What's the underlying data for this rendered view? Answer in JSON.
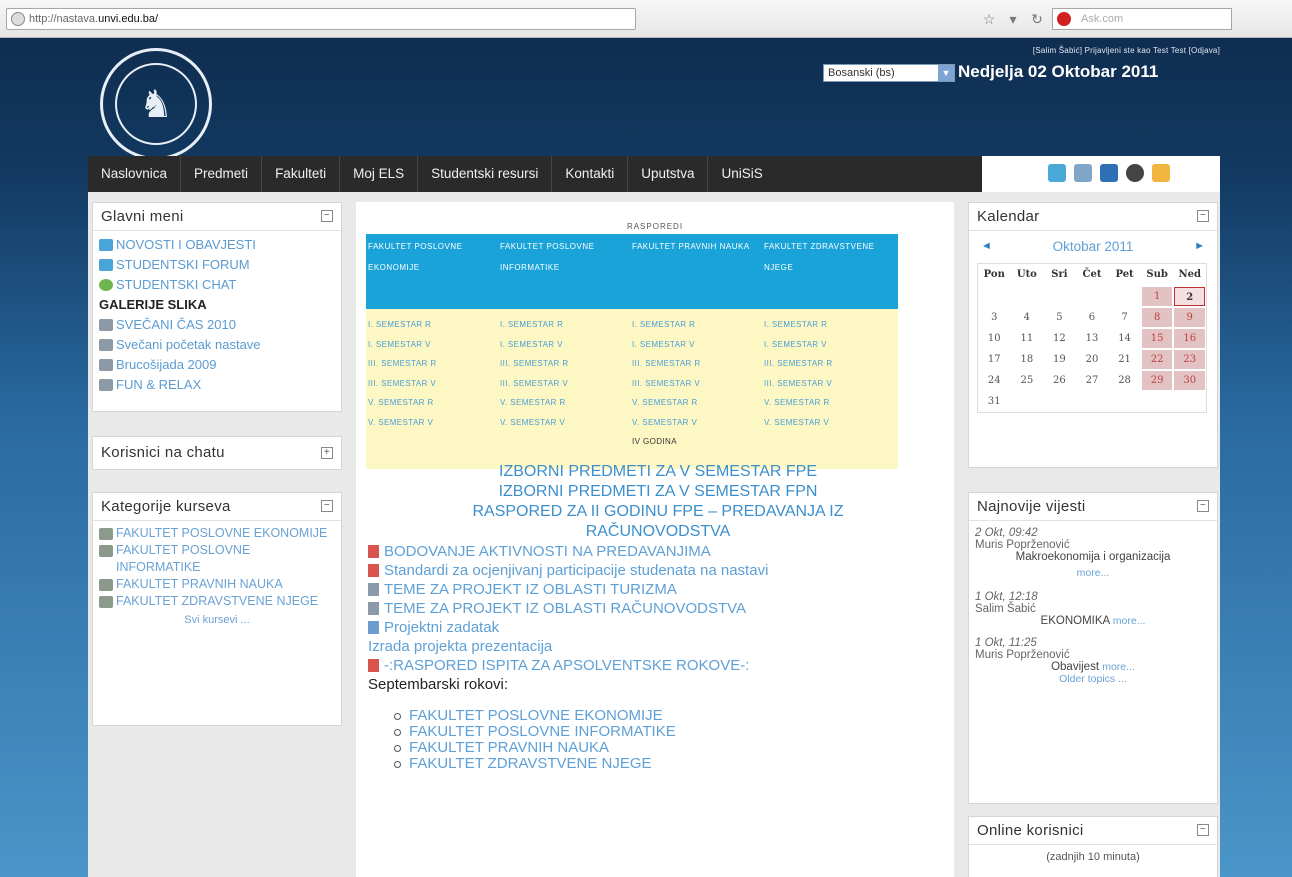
{
  "browser": {
    "url_prefix": "http://nastava.",
    "url_host": "unvi.edu.ba/",
    "search_placeholder": "Ask.com"
  },
  "header": {
    "login_info": "[Salim Šabić] Prijavljeni ste kao Test Test [Odjava]",
    "language": "Bosanski (bs)",
    "date": "Nedjelja 02 Oktobar 2011"
  },
  "nav": {
    "items": [
      "Naslovnica",
      "Predmeti",
      "Fakulteti",
      "Moj ELS",
      "Studentski resursi",
      "Kontakti",
      "Uputstva",
      "UniSiS"
    ]
  },
  "main_menu": {
    "title": "Glavni meni",
    "items": [
      {
        "label": "NOVOSTI I OBAVJESTI",
        "icon": "news-icon"
      },
      {
        "label": "STUDENTSKI FORUM",
        "icon": "forum-icon"
      },
      {
        "label": "STUDENTSKI CHAT",
        "icon": "chat-icon"
      },
      {
        "label": "GALERIJE SLIKA",
        "icon": ""
      },
      {
        "label": "SVEČANI ČAS 2010",
        "icon": "gallery-icon"
      },
      {
        "label": "Svečani početak nastave",
        "icon": "gallery-icon"
      },
      {
        "label": "Brucošijada 2009",
        "icon": "gallery-icon"
      },
      {
        "label": "FUN & RELAX",
        "icon": "gallery-icon"
      }
    ]
  },
  "chat_users": {
    "title": "Korisnici na chatu"
  },
  "categories": {
    "title": "Kategorije kurseva",
    "items": [
      "FAKULTET POSLOVNE EKONOMIJE",
      "FAKULTET POSLOVNE INFORMATIKE",
      "FAKULTET PRAVNIH NAUKA",
      "FAKULTET ZDRAVSTVENE NJEGE"
    ],
    "all_courses": "Svi kursevi ..."
  },
  "schedule": {
    "title": "RASPOREDI",
    "headers": [
      "FAKULTET POSLOVNE EKONOMIJE",
      "FAKULTET POSLOVNE INFORMATIKE",
      "FAKULTET PRAVNIH NAUKA",
      "FAKULTET ZDRAVSTVENE NJEGE"
    ],
    "col1": [
      "I. SEMESTAR R",
      "I. SEMESTAR V",
      "III. SEMESTAR R",
      "III. SEMESTAR V",
      "V. SEMESTAR R",
      "V. SEMESTAR V"
    ],
    "col2": [
      "I. SEMESTAR R",
      "I. SEMESTAR V",
      "III. SEMESTAR R",
      "III. SEMESTAR V",
      "V. SEMESTAR R",
      "V. SEMESTAR V"
    ],
    "col3": [
      "I. SEMESTAR R",
      "I. SEMESTAR V",
      "III. SEMESTAR R",
      "III. SEMESTAR V",
      "V. SEMESTAR R",
      "V. SEMESTAR V",
      "IV GODINA"
    ],
    "col4": [
      "I. SEMESTAR R",
      "I. SEMESTAR V",
      "III. SEMESTAR R",
      "III. SEMESTAR V",
      "V. SEMESTAR R",
      "V. SEMESTAR V"
    ]
  },
  "content": {
    "heading1": "IZBORNI PREDMETI ZA V SEMESTAR FPE",
    "heading2": "IZBORNI PREDMETI ZA V SEMESTAR FPN",
    "heading3a": "RASPORED ZA II GODINU FPE – PREDAVANJA IZ",
    "heading3b": "RAČUNOVODSTVA",
    "link1": "BODOVANJE AKTIVNOSTI NA PREDAVANJIMA",
    "link2": "Standardi za ocjenjivanj participacije studenata na nastavi",
    "link3": "TEME ZA PROJEKT IZ OBLASTI TURIZMA",
    "link4": "TEME ZA PROJEKT IZ OBLASTI RAČUNOVODSTVA",
    "link5": "Projektni zadatak",
    "link6": "Izrada projekta prezentacija",
    "link7": "-:RASPORED ISPITA ZA APSOLVENTSKE ROKOVE-:",
    "text1": "Septembarski rokovi:",
    "bullets": [
      "FAKULTET POSLOVNE EKONOMIJE",
      "FAKULTET POSLOVNE INFORMATIKE",
      "FAKULTET PRAVNIH NAUKA",
      "FAKULTET ZDRAVSTVENE NJEGE"
    ]
  },
  "calendar": {
    "title": "Kalendar",
    "month": "Oktobar 2011",
    "weekdays": [
      "Pon",
      "Uto",
      "Sri",
      "Čet",
      "Pet",
      "Sub",
      "Ned"
    ],
    "today": 2
  },
  "latest_news": {
    "title": "Najnovije vijesti",
    "entries": [
      {
        "date": "2 Okt, 09:42",
        "author": "Muris Poprženović",
        "title": "Makroekonomija i organizacija",
        "more": "more..."
      },
      {
        "date": "1 Okt, 12:18",
        "author": "Salim Šabić",
        "title": "EKONOMIKA",
        "more": "more..."
      },
      {
        "date": "1 Okt, 11:25",
        "author": "Muris Poprženović",
        "title": "Obavijest",
        "more": "more..."
      }
    ],
    "older": "Older topics ..."
  },
  "online_users": {
    "title": "Online korisnici",
    "subtitle": "(zadnjih 10 minuta)"
  }
}
